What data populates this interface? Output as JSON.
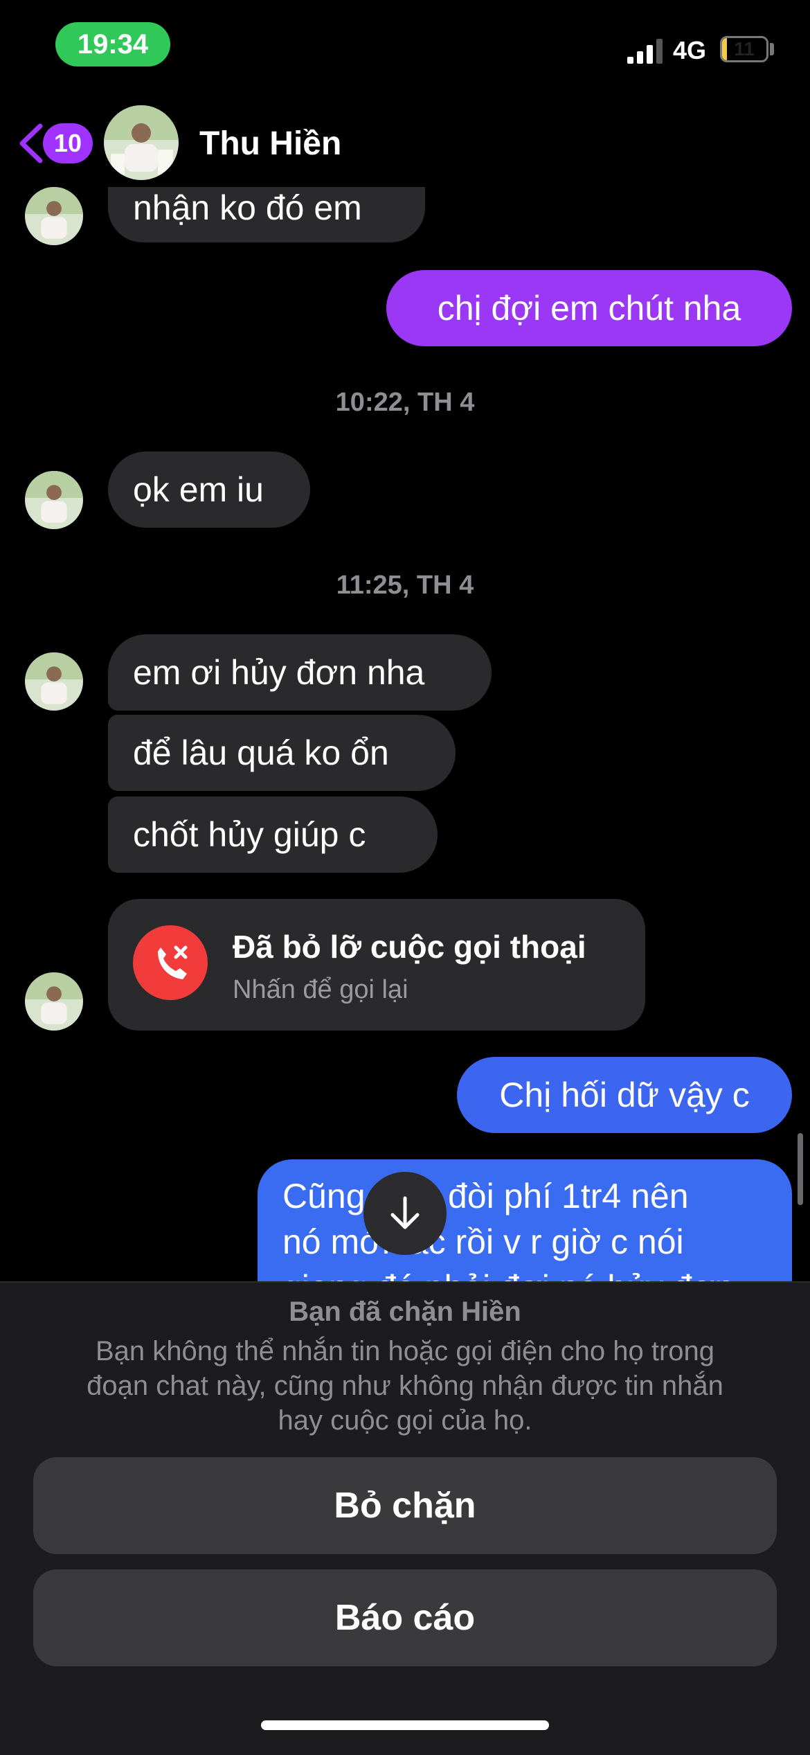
{
  "status_bar": {
    "time": "19:34",
    "network": "4G",
    "battery_level": "11",
    "battery_fraction": 0.11,
    "time_pill_color": "#31c85a"
  },
  "header": {
    "back_badge": "10",
    "contact_name": "Thu Hiền",
    "accent_color": "#a033ff"
  },
  "messages": {
    "m1": "nhận ko đó em",
    "m2": "chị đợi em chút nha",
    "t1": "10:22, TH 4",
    "m3": "ọk em iu",
    "t2": "11:25, TH 4",
    "m4": "em ơi hủy đơn nha",
    "m5": "để lâu quá ko ổn",
    "m6": "chốt hủy giúp c",
    "call": {
      "title": "Đã bỏ lỡ cuộc gọi thoại",
      "subtitle": "Nhấn để gọi lại"
    },
    "m7": "Chị hối dữ vậy c",
    "m8_line1": "Cũng tại c đòi phí 1tr4 nên",
    "m8_line2": "nó mới tác rồi v r giờ c nói",
    "m8_line3": "giọng đó phải đợi nó hủy đơn"
  },
  "blocked": {
    "title": "Bạn đã chặn Hiền",
    "desc_line1": "Bạn không thể nhắn tin hoặc gọi điện cho họ trong",
    "desc_line2": "đoạn chat này, cũng như không nhận được tin nhắn",
    "desc_line3": "hay cuộc gọi của họ.",
    "unblock_label": "Bỏ chặn",
    "report_label": "Báo cáo"
  },
  "icons": {
    "back": "chevron-left-icon",
    "call": "missed-call-icon",
    "scroll": "arrow-down-icon",
    "signal": "signal-icon",
    "battery": "battery-icon"
  }
}
